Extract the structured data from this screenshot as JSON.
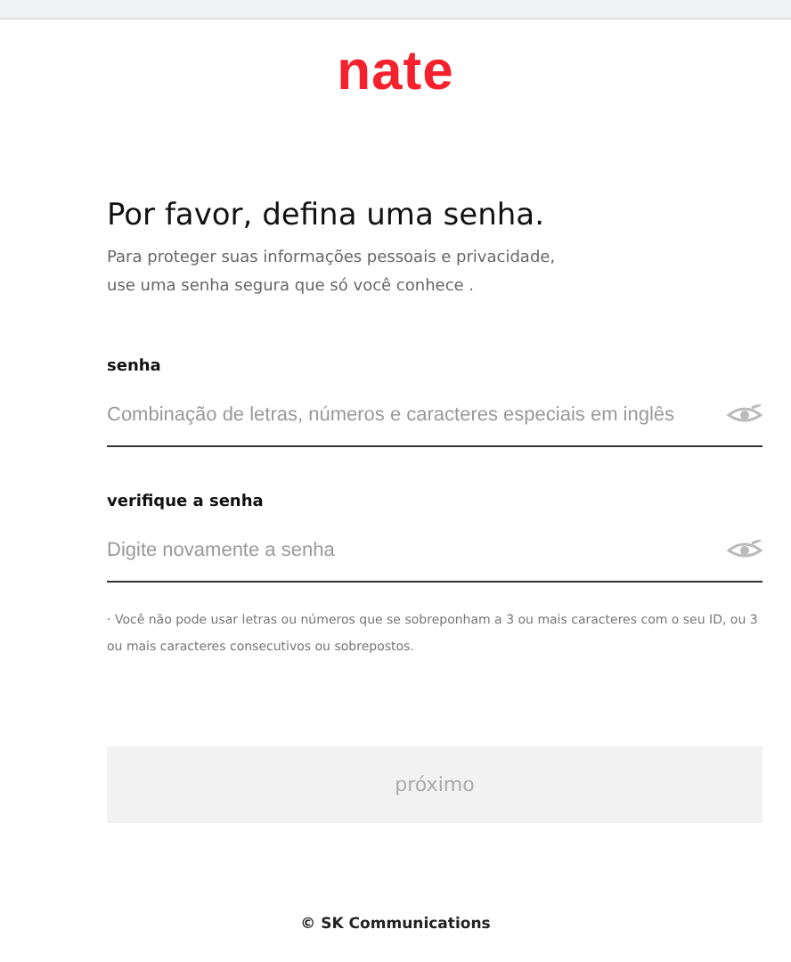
{
  "logo": "nate",
  "title": "Por favor, defina uma senha.",
  "subtitle_lines": [
    "Para proteger suas informações pessoais e privacidade,",
    "use uma senha segura que só você conhece ."
  ],
  "fields": [
    {
      "label": "senha",
      "placeholder": "Combinação de letras, números e caracteres especiais em inglês"
    },
    {
      "label": "verifique a senha",
      "placeholder": "Digite novamente a senha"
    }
  ],
  "note": "· Você não pode usar letras ou números que se sobreponham a 3 ou mais caracteres com o seu ID, ou 3 ou mais caracteres consecutivos ou sobrepostos.",
  "next_button": {
    "label": "próximo",
    "disabled": true
  },
  "footer": "© SK Communications"
}
